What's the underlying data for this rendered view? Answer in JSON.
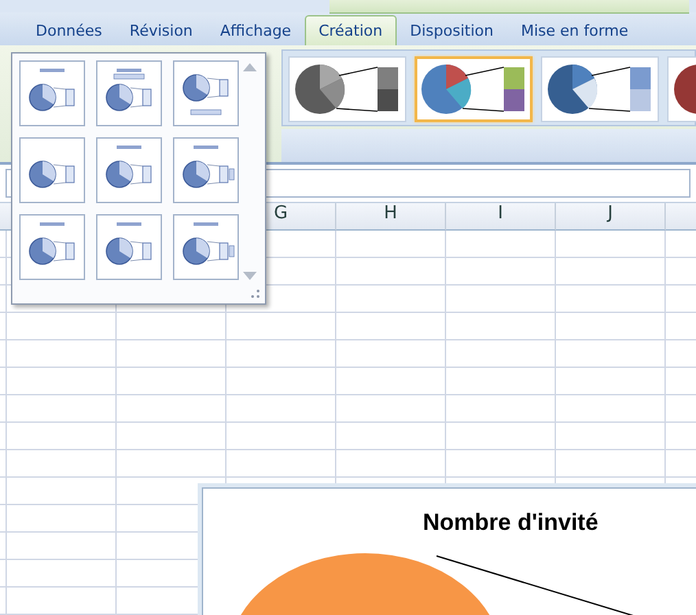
{
  "tabs": [
    {
      "label": "Données",
      "selected": false
    },
    {
      "label": "Révision",
      "selected": false
    },
    {
      "label": "Affichage",
      "selected": false
    },
    {
      "label": "Création",
      "selected": true
    },
    {
      "label": "Disposition",
      "selected": false
    },
    {
      "label": "Mise en forme",
      "selected": false
    }
  ],
  "chart_styles": [
    {
      "kind": "grey",
      "selected": false
    },
    {
      "kind": "colorful",
      "selected": true
    },
    {
      "kind": "blue",
      "selected": false
    },
    {
      "kind": "red",
      "selected": false
    }
  ],
  "columns": [
    {},
    {
      "label": "G"
    },
    {
      "label": "H"
    },
    {
      "label": "I"
    },
    {
      "label": "J"
    },
    {}
  ],
  "chart": {
    "title": "Nombre d'invité"
  }
}
